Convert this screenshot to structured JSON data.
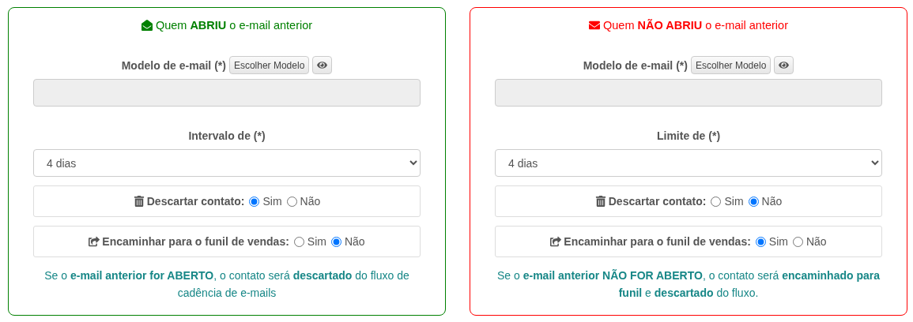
{
  "panels": [
    {
      "color": "#008000",
      "kind": "opened",
      "title": "Quem **ABRIU** o e-mail anterior",
      "template": {
        "label": "Modelo de e-mail (*)",
        "button": "Escolher Modelo"
      },
      "select": {
        "label": "Intervalo de (*)",
        "value": "4 dias"
      },
      "radio_groups": [
        {
          "label": "Descartar contato:",
          "options": [
            {
              "label": "Sim",
              "selected": true
            },
            {
              "label": "Não",
              "selected": false
            }
          ]
        },
        {
          "label": "Encaminhar para o funil de vendas:",
          "options": [
            {
              "label": "Sim",
              "selected": false
            },
            {
              "label": "Não",
              "selected": true
            }
          ]
        }
      ],
      "note": "Se o **e-mail anterior for ABERTO**, o contato será **descartado** do fluxo de cadência de e-mails"
    },
    {
      "color": "#ff0000",
      "kind": "unopened",
      "title": "Quem **NÃO ABRIU** o e-mail anterior",
      "template": {
        "label": "Modelo de e-mail (*)",
        "button": "Escolher Modelo"
      },
      "select": {
        "label": "Limite de (*)",
        "value": "4 dias"
      },
      "radio_groups": [
        {
          "label": "Descartar contato:",
          "options": [
            {
              "label": "Sim",
              "selected": false
            },
            {
              "label": "Não",
              "selected": true
            }
          ]
        },
        {
          "label": "Encaminhar para o funil de vendas:",
          "options": [
            {
              "label": "Sim",
              "selected": true
            },
            {
              "label": "Não",
              "selected": false
            }
          ]
        }
      ],
      "note": "Se o **e-mail anterior NÃO FOR ABERTO**, o contato será **encaminhado para funil** e **descartado** do fluxo."
    }
  ]
}
